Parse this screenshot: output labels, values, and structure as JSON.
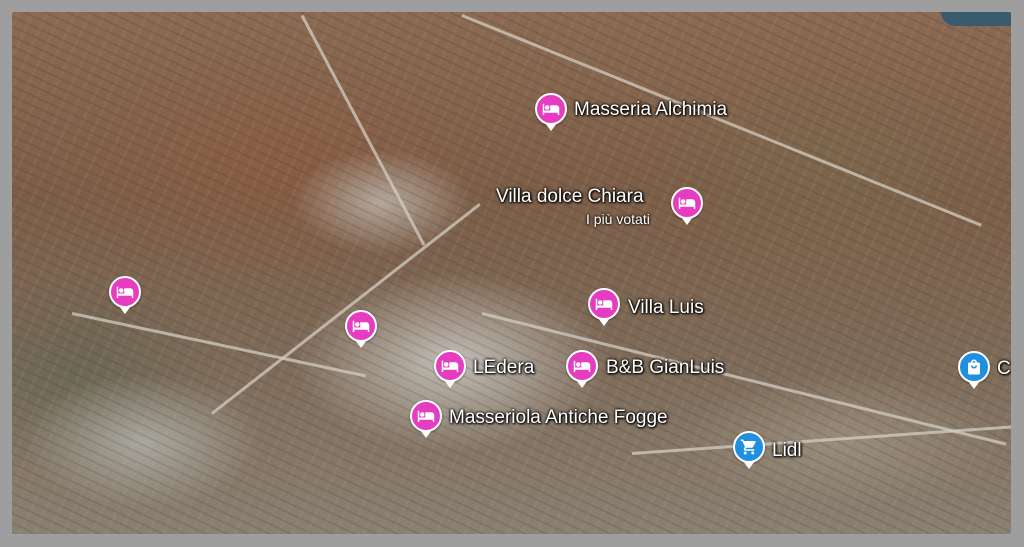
{
  "colors": {
    "hotel_pin": "#e63cbf",
    "shop_pin": "#1f8fe0"
  },
  "markers": [
    {
      "type": "hotel",
      "icon": "bed-icon",
      "label": "Masseria Alchimia",
      "sublabel": ""
    },
    {
      "type": "hotel",
      "icon": "bed-icon",
      "label": "Villa dolce Chiara",
      "sublabel": "I più votati"
    },
    {
      "type": "hotel",
      "icon": "bed-icon",
      "label": "",
      "sublabel": ""
    },
    {
      "type": "hotel",
      "icon": "bed-icon",
      "label": "Villa Luis",
      "sublabel": ""
    },
    {
      "type": "hotel",
      "icon": "bed-icon",
      "label": "",
      "sublabel": ""
    },
    {
      "type": "hotel",
      "icon": "bed-icon",
      "label": "LEdera",
      "sublabel": ""
    },
    {
      "type": "hotel",
      "icon": "bed-icon",
      "label": "B&B GianLuis",
      "sublabel": ""
    },
    {
      "type": "hotel",
      "icon": "bed-icon",
      "label": "Masseriola Antiche Fogge",
      "sublabel": ""
    },
    {
      "type": "shop",
      "icon": "shopping-cart-icon",
      "label": "Lidl",
      "sublabel": ""
    },
    {
      "type": "shop",
      "icon": "shopping-bag-icon",
      "label": "C",
      "sublabel": ""
    }
  ]
}
